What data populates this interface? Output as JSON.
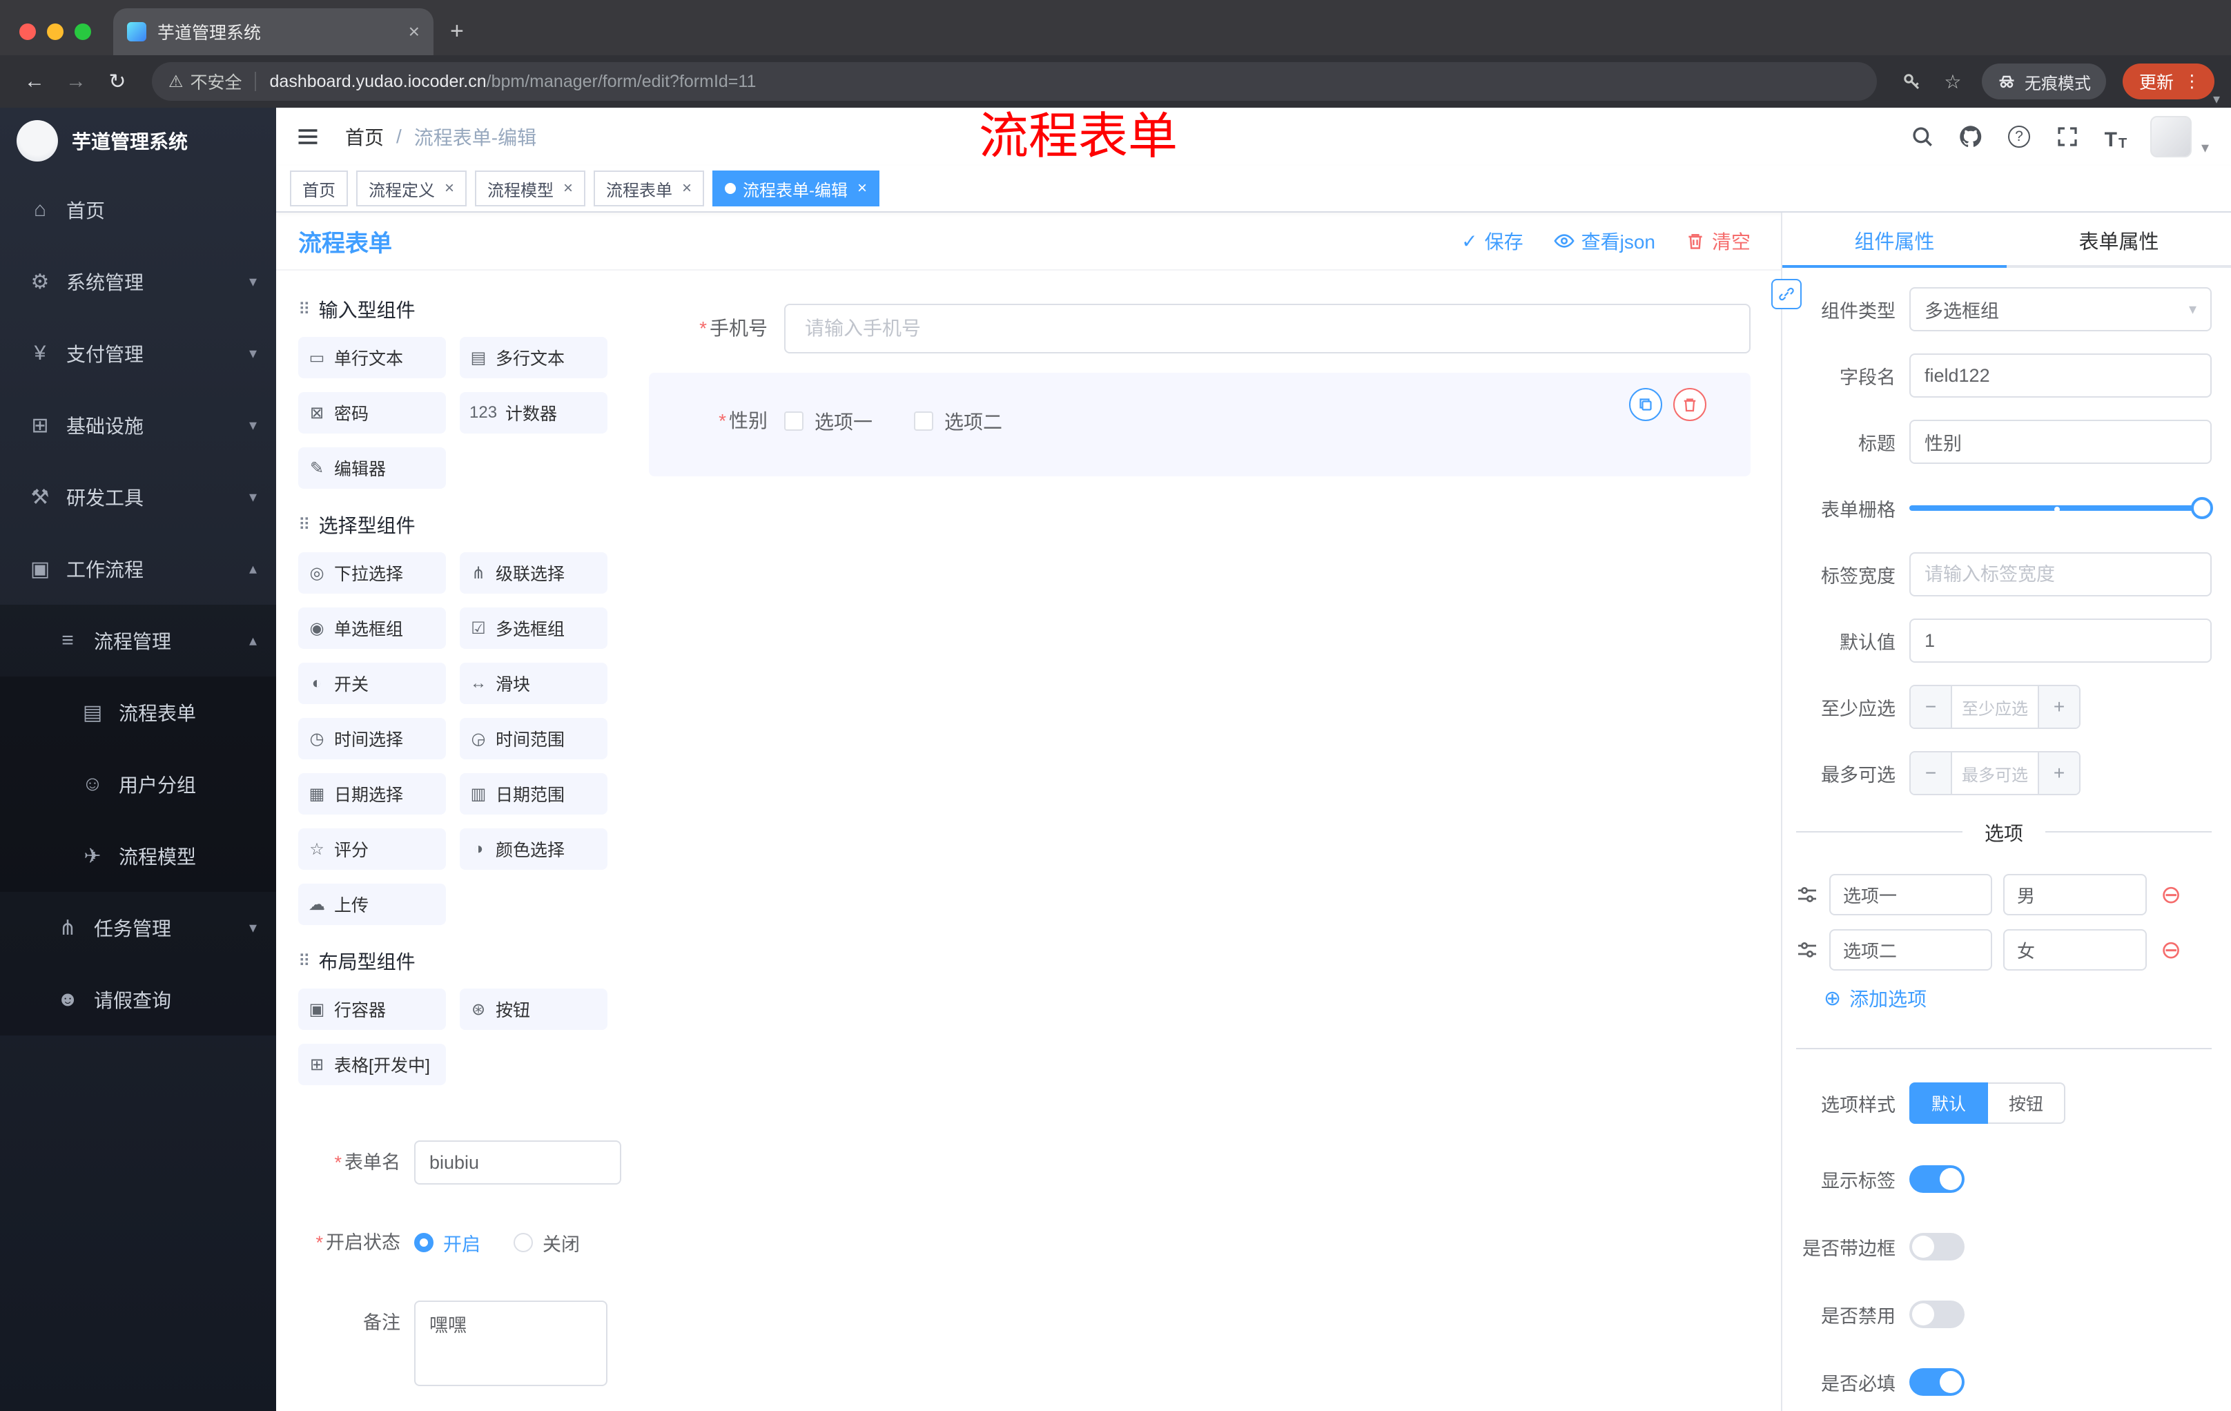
{
  "colors": {
    "accent": "#409EFF",
    "danger": "#F56C6C",
    "overlay_red": "#FE0000",
    "update_pill": "#CF4B2E"
  },
  "icons": {
    "close": "×",
    "plus": "+",
    "back": "←",
    "forward": "→",
    "reload": "↻",
    "warning": "⚠",
    "more": "⋮",
    "caret": "▾",
    "star": "☆",
    "slash": "/",
    "question": "?",
    "t_large": "T",
    "t_small": "T",
    "home": "⌂",
    "gear": "⚙",
    "yen": "¥",
    "grid": "⊞",
    "tools": "⚒",
    "briefcase": "▣",
    "list": "≡",
    "doc": "▤",
    "chat": "☺",
    "send": "✈",
    "tree": "⋔",
    "person": "☻",
    "chev_down": "▾",
    "chev_up": "▴",
    "drag": "⠿",
    "check": "✓",
    "asterisk": "*",
    "minus_circle": "⊖",
    "plus_circle": "⊕",
    "minus": "−"
  },
  "browser": {
    "tab_title": "芋道管理系统",
    "security": "不安全",
    "host": "dashboard.yudao.iocoder.cn",
    "path": "/bpm/manager/form/edit?formId=11",
    "incognito": "无痕模式",
    "update": "更新"
  },
  "sidebar": {
    "title": "芋道管理系统",
    "items": {
      "home": "首页",
      "system": "系统管理",
      "pay": "支付管理",
      "infra": "基础设施",
      "dev": "研发工具",
      "workflow": "工作流程",
      "process": "流程管理",
      "form": "流程表单",
      "group": "用户分组",
      "model": "流程模型",
      "task": "任务管理",
      "leave": "请假查询"
    }
  },
  "header": {
    "breadcrumb_home": "首页",
    "breadcrumb_current": "流程表单-编辑",
    "overlay": "流程表单"
  },
  "tags": [
    {
      "label": "首页"
    },
    {
      "label": "流程定义"
    },
    {
      "label": "流程模型"
    },
    {
      "label": "流程表单"
    },
    {
      "label": "流程表单-编辑"
    }
  ],
  "designer": {
    "title": "流程表单",
    "save": "保存",
    "view_json": "查看json",
    "clear": "清空"
  },
  "components": {
    "input": {
      "title": "输入型组件",
      "items": [
        {
          "icon": "▭",
          "label": "单行文本"
        },
        {
          "icon": "▤",
          "label": "多行文本"
        },
        {
          "icon": "⊠",
          "label": "密码"
        },
        {
          "icon": "123",
          "label": "计数器"
        },
        {
          "icon": "✎",
          "label": "编辑器"
        }
      ]
    },
    "select": {
      "title": "选择型组件",
      "items": [
        {
          "icon": "◎",
          "label": "下拉选择"
        },
        {
          "icon": "⋔",
          "label": "级联选择"
        },
        {
          "icon": "◉",
          "label": "单选框组"
        },
        {
          "icon": "☑",
          "label": "多选框组"
        },
        {
          "icon": "◐",
          "label": "开关"
        },
        {
          "icon": "↔",
          "label": "滑块"
        },
        {
          "icon": "◷",
          "label": "时间选择"
        },
        {
          "icon": "◶",
          "label": "时间范围"
        },
        {
          "icon": "▦",
          "label": "日期选择"
        },
        {
          "icon": "▥",
          "label": "日期范围"
        },
        {
          "icon": "☆",
          "label": "评分"
        },
        {
          "icon": "◑",
          "label": "颜色选择"
        },
        {
          "icon": "☁",
          "label": "上传"
        }
      ]
    },
    "layout": {
      "title": "布局型组件",
      "items": [
        {
          "icon": "▣",
          "label": "行容器"
        },
        {
          "icon": "⊛",
          "label": "按钮"
        },
        {
          "icon": "⊞",
          "label": "表格[开发中]"
        }
      ]
    }
  },
  "form_meta": {
    "name_label": "表单名",
    "name_value": "biubiu",
    "status_label": "开启状态",
    "status_on": "开启",
    "status_off": "关闭",
    "remark_label": "备注",
    "remark_value": "嘿嘿"
  },
  "canvas": {
    "phone_label": "手机号",
    "phone_placeholder": "请输入手机号",
    "gender_label": "性别",
    "gender_opt1": "选项一",
    "gender_opt2": "选项二"
  },
  "props": {
    "tab_component": "组件属性",
    "tab_form": "表单属性",
    "type_label": "组件类型",
    "type_value": "多选框组",
    "field_label": "字段名",
    "field_value": "field122",
    "title_label": "标题",
    "title_value": "性别",
    "grid_label": "表单栅格",
    "width_label": "标签宽度",
    "width_placeholder": "请输入标签宽度",
    "default_label": "默认值",
    "default_value": "1",
    "min_label": "至少应选",
    "min_placeholder": "至少应选",
    "max_label": "最多可选",
    "max_placeholder": "最多可选",
    "options_title": "选项",
    "options": [
      {
        "label": "选项一",
        "value": "男"
      },
      {
        "label": "选项二",
        "value": "女"
      }
    ],
    "add_option": "添加选项",
    "style_label": "选项样式",
    "style_default": "默认",
    "style_button": "按钮",
    "show_label": "显示标签",
    "with_border": "是否带边框",
    "disabled_label": "是否禁用",
    "required_label": "是否必填"
  }
}
